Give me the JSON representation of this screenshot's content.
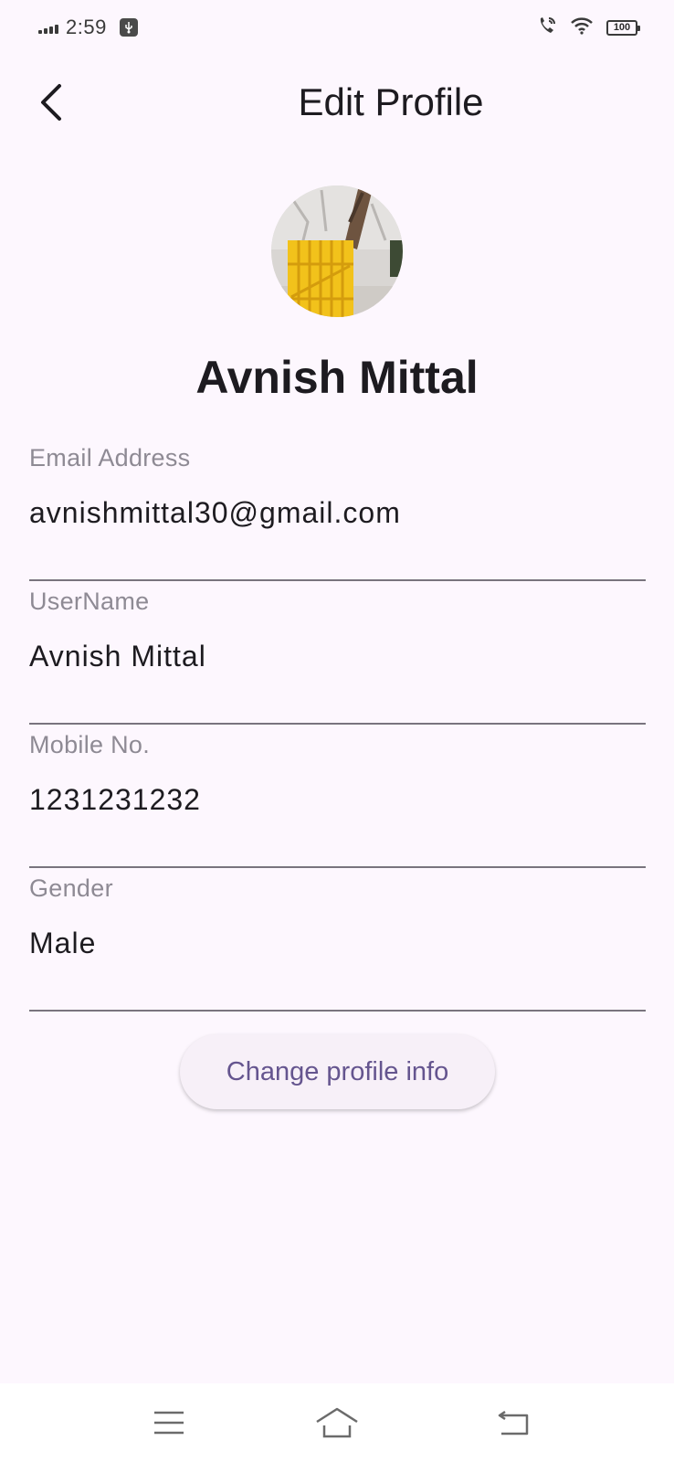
{
  "status_bar": {
    "time": "2:59",
    "battery": "100",
    "icons": [
      "signal-icon",
      "usb-debug-icon",
      "wifi-calling-icon",
      "wifi-icon",
      "battery-icon"
    ]
  },
  "app_bar": {
    "title": "Edit Profile",
    "back_icon": "back-arrow-icon"
  },
  "profile": {
    "name": "Avnish Mittal",
    "avatar": "avatar-photo"
  },
  "fields": [
    {
      "label": "Email Address",
      "value": "avnishmittal30@gmail.com"
    },
    {
      "label": "UserName",
      "value": "Avnish Mittal"
    },
    {
      "label": "Mobile No.",
      "value": "1231231232"
    },
    {
      "label": "Gender",
      "value": "Male"
    }
  ],
  "actions": {
    "change_profile_label": "Change profile info"
  },
  "nav_bar": {
    "icons": [
      "menu-icon",
      "home-icon",
      "back-icon"
    ]
  },
  "colors": {
    "background": "#fdf7fe",
    "accent": "#65558f",
    "divider": "#79747e",
    "label": "#8e8a94"
  }
}
